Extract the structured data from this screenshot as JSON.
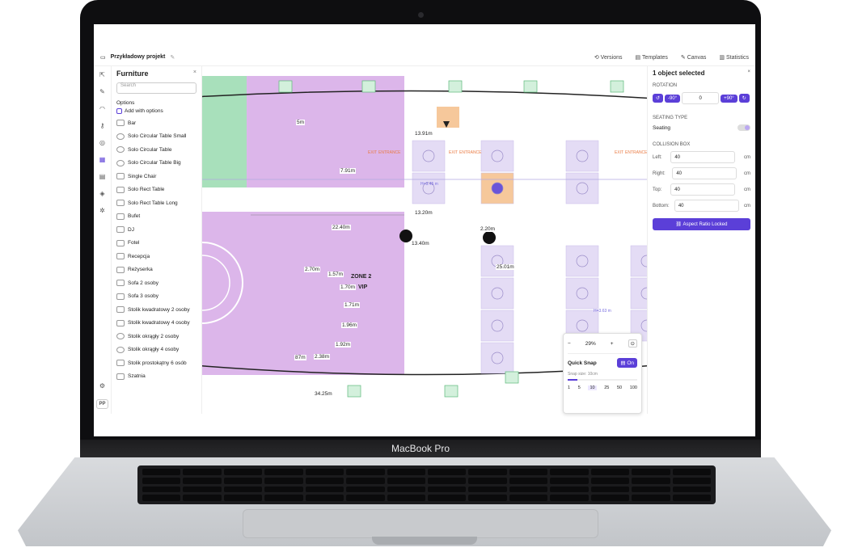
{
  "device": {
    "label": "MacBook Pro"
  },
  "topbar": {
    "project": "Przykładowy projekt",
    "versions": "Versions",
    "templates": "Templates",
    "canvas": "Canvas",
    "statistics": "Statistics"
  },
  "panel": {
    "title": "Furniture",
    "search_placeholder": "Search",
    "options_label": "Options",
    "add_with_options": "Add with options",
    "items": [
      "Bar",
      "Solo Circular Table Small",
      "Solo Circular Table",
      "Solo Circular Table Big",
      "Single Chair",
      "Solo Rect Table",
      "Solo Rect Table Long",
      "Bufet",
      "DJ",
      "Fotel",
      "Recepcja",
      "Reżyserka",
      "Sofa 2 osoby",
      "Sofa 3 osoby",
      "Stolik kwadratowy 2 osoby",
      "Stolik kwadratowy 4 osoby",
      "Stolik okrągły 2 osoby",
      "Stolik okrągły 4 osoby",
      "Stolik prostokątny 6 osób",
      "Szatnia"
    ]
  },
  "avatar": "PP",
  "right": {
    "title": "1 object selected",
    "rotation": "ROTATION",
    "rot_minus": "-90°",
    "rot_value": "0",
    "rot_plus": "+90°",
    "seating_type": "SEATING TYPE",
    "seating": "Seating",
    "collision": "COLLISION BOX",
    "left_label": "Left:",
    "left": "40",
    "right_label": "Right:",
    "right": "40",
    "top_label": "Top:",
    "top": "40",
    "bottom_label": "Bottom:",
    "bottom": "40",
    "unit": "cm",
    "aspect": "Aspect Ratio Locked"
  },
  "zoom": {
    "minus": "−",
    "value": "29%",
    "plus": "+",
    "snap": "Quick Snap",
    "on": "On",
    "snap_size": "Snap size: 10cm",
    "steps": [
      "1",
      "5",
      "10",
      "25",
      "50",
      "100"
    ]
  },
  "canvas": {
    "zone": "ZONE 2",
    "vip": "VIP",
    "exit": "EXIT",
    "entrance": "ENTRANCE",
    "measures": [
      "13.91m",
      "7.91m",
      "13.20m",
      "22.40m",
      "13.40m",
      "2.20m",
      "25.01m",
      "2.70m",
      "1.57m",
      "1.70m",
      "1.71m",
      "1.96m",
      "1.92m",
      "2.38m",
      "87m",
      "34.25m",
      "5m"
    ],
    "dims": [
      "H=3.45 m",
      "H=3.63 m"
    ]
  },
  "colors": {
    "accent": "#5b3fd8",
    "zone": "#dcb6ea",
    "green_zone": "#a8e0bb",
    "selected": "#f6c89b"
  }
}
